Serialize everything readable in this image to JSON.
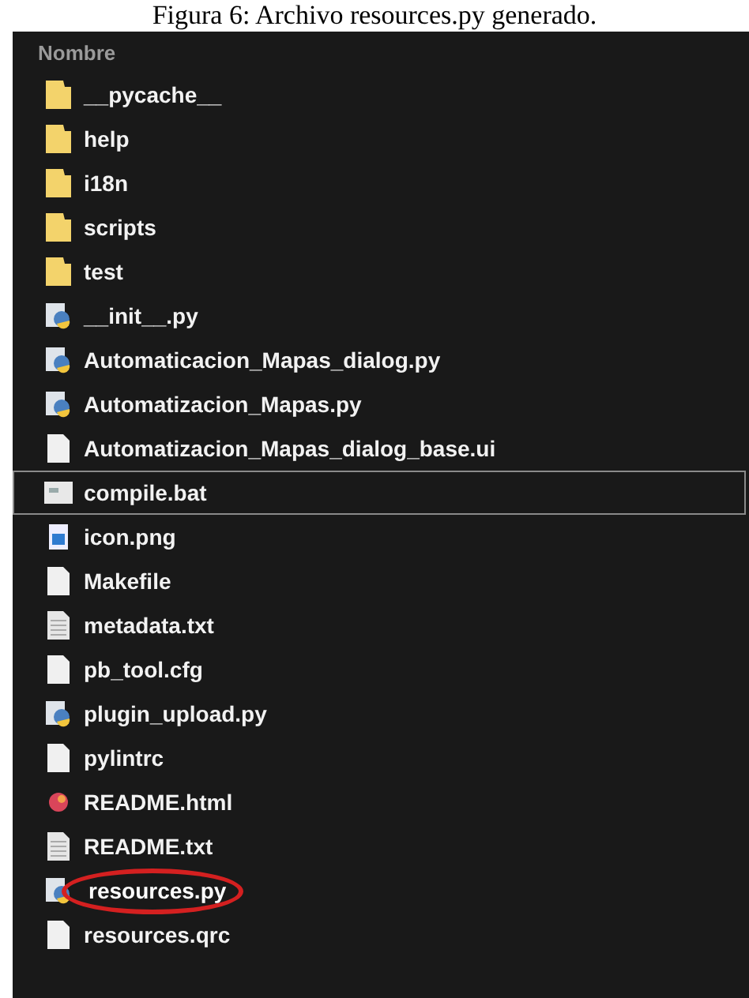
{
  "caption": "Figura 6: Archivo resources.py generado.",
  "column_header": "Nombre",
  "files": [
    {
      "name": "__pycache__",
      "kind": "folder",
      "focused": false,
      "circled": false
    },
    {
      "name": "help",
      "kind": "folder",
      "focused": false,
      "circled": false
    },
    {
      "name": "i18n",
      "kind": "folder",
      "focused": false,
      "circled": false
    },
    {
      "name": "scripts",
      "kind": "folder",
      "focused": false,
      "circled": false
    },
    {
      "name": "test",
      "kind": "folder",
      "focused": false,
      "circled": false
    },
    {
      "name": "__init__.py",
      "kind": "python",
      "focused": false,
      "circled": false
    },
    {
      "name": "Automaticacion_Mapas_dialog.py",
      "kind": "python",
      "focused": false,
      "circled": false
    },
    {
      "name": "Automatizacion_Mapas.py",
      "kind": "python",
      "focused": false,
      "circled": false
    },
    {
      "name": "Automatizacion_Mapas_dialog_base.ui",
      "kind": "file",
      "focused": false,
      "circled": false
    },
    {
      "name": "compile.bat",
      "kind": "batch",
      "focused": true,
      "circled": false
    },
    {
      "name": "icon.png",
      "kind": "image",
      "focused": false,
      "circled": false
    },
    {
      "name": "Makefile",
      "kind": "file",
      "focused": false,
      "circled": false
    },
    {
      "name": "metadata.txt",
      "kind": "text",
      "focused": false,
      "circled": false
    },
    {
      "name": "pb_tool.cfg",
      "kind": "file",
      "focused": false,
      "circled": false
    },
    {
      "name": "plugin_upload.py",
      "kind": "python",
      "focused": false,
      "circled": false
    },
    {
      "name": "pylintrc",
      "kind": "file",
      "focused": false,
      "circled": false
    },
    {
      "name": "README.html",
      "kind": "html",
      "focused": false,
      "circled": false
    },
    {
      "name": "README.txt",
      "kind": "text",
      "focused": false,
      "circled": false
    },
    {
      "name": "resources.py",
      "kind": "python",
      "focused": false,
      "circled": true
    },
    {
      "name": "resources.qrc",
      "kind": "file",
      "focused": false,
      "circled": false
    }
  ]
}
